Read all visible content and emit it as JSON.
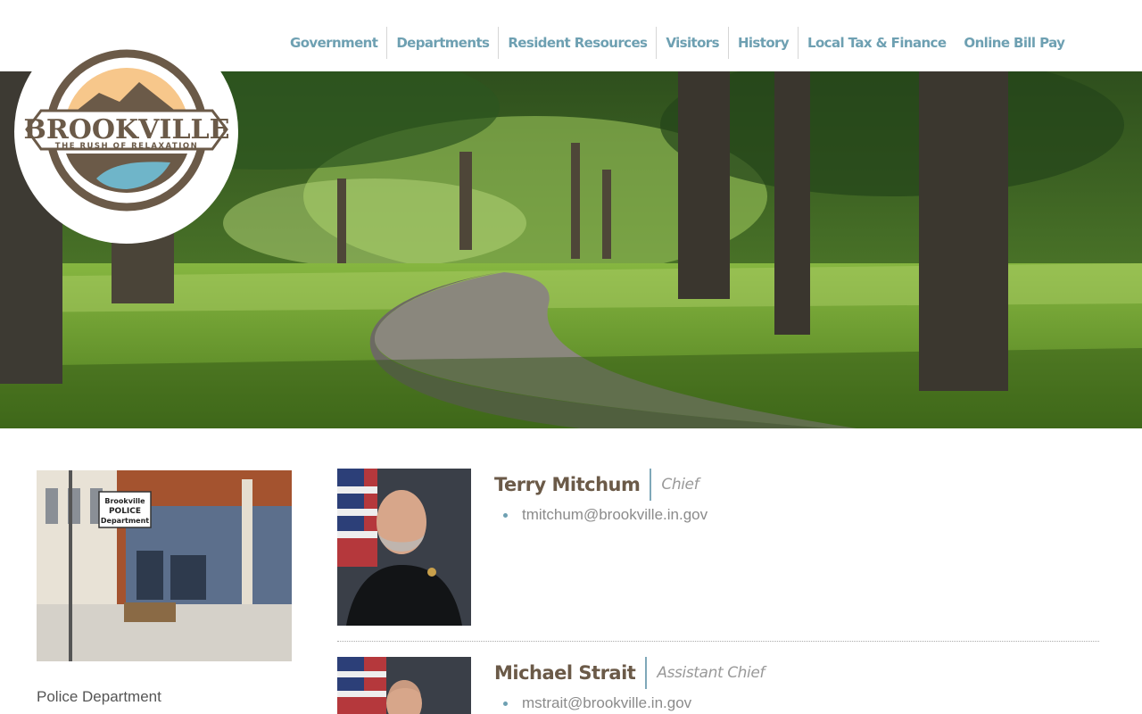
{
  "nav": {
    "items": [
      "Government",
      "Departments",
      "Resident Resources",
      "Visitors",
      "History",
      "Local Tax & Finance",
      "Online Bill Pay"
    ]
  },
  "logo": {
    "main_text": "BROOKVILLE",
    "tagline": "THE RUSH OF RELAXATION",
    "colors": {
      "ring": "#6b5a48",
      "sun": "#f7c78b",
      "water": "#6fb5c9"
    }
  },
  "sidebar": {
    "photo_alt": "Police Department building",
    "sign_text": [
      "Brookville",
      "POLICE",
      "Department"
    ],
    "caption": "Police Department"
  },
  "staff": [
    {
      "name": "Terry Mitchum",
      "title": "Chief",
      "email": "tmitchum@brookville.in.gov"
    },
    {
      "name": "Michael Strait",
      "title": "Assistant Chief",
      "email": "mstrait@brookville.in.gov"
    }
  ],
  "colors": {
    "nav": "#6ea0b2",
    "name": "#6b5a48",
    "accent": "#7fa8b9"
  }
}
